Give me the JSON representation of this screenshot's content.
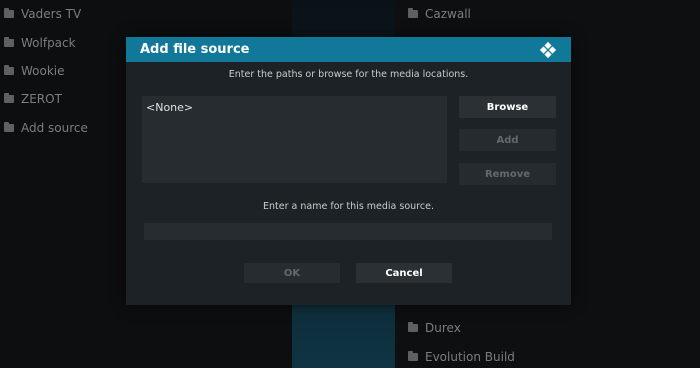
{
  "background": {
    "left_items": [
      "Vaders TV",
      "Wolfpack",
      "Wookie",
      "ZEROT",
      "Add source"
    ],
    "right_items": [
      "Cazwall",
      "Durex",
      "Evolution Build"
    ]
  },
  "dialog": {
    "title": "Add file source",
    "icon": "kodi-logo-icon",
    "paths_instruction": "Enter the paths or browse for the media locations.",
    "paths": [
      "<None>"
    ],
    "buttons": {
      "browse": "Browse",
      "add": "Add",
      "remove": "Remove",
      "ok": "OK",
      "cancel": "Cancel"
    },
    "name_instruction": "Enter a name for this media source.",
    "name_value": ""
  },
  "colors": {
    "header": "#12789a",
    "dialog_bg": "#1c2226"
  }
}
